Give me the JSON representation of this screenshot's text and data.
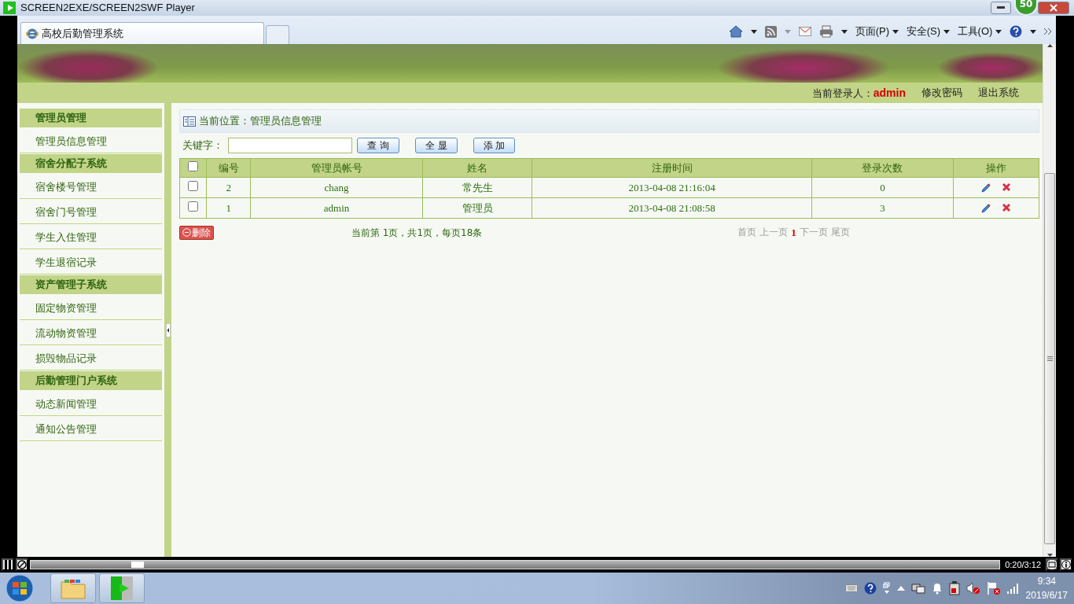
{
  "player": {
    "title": "SCREEN2EXE/SCREEN2SWF Player",
    "badge": "50",
    "time": "0:20/3:12",
    "level": 0.11
  },
  "browser": {
    "tab": "高校后勤管理系统",
    "menus": [
      "页面(P)",
      "安全(S)",
      "工具(O)"
    ]
  },
  "header": {
    "login_label": "当前登录人：",
    "user": "admin",
    "links": [
      "修改密码",
      "退出系统"
    ]
  },
  "sidebar": [
    {
      "title": "管理员管理",
      "items": [
        "管理员信息管理"
      ]
    },
    {
      "title": "宿舍分配子系统",
      "items": [
        "宿舍楼号管理",
        "宿舍门号管理",
        "学生入住管理",
        "学生退宿记录"
      ]
    },
    {
      "title": "资产管理子系统",
      "items": [
        "固定物资管理",
        "流动物资管理",
        "损毁物品记录"
      ]
    },
    {
      "title": "后勤管理门户系统",
      "items": [
        "动态新闻管理",
        "通知公告管理"
      ]
    }
  ],
  "breadcrumb": "当前位置：管理员信息管理",
  "search": {
    "label": "关键字：",
    "buttons": [
      "查 询",
      "全 显",
      "添 加"
    ]
  },
  "table": {
    "select_all_checked": false,
    "columns": [
      "编号",
      "管理员帐号",
      "姓名",
      "注册时间",
      "登录次数",
      "操作"
    ],
    "rows": [
      {
        "checked": false,
        "cells": [
          "2",
          "chang",
          "常先生",
          "2013-04-08 21:16:04",
          "0"
        ]
      },
      {
        "checked": false,
        "cells": [
          "1",
          "admin",
          "管理员",
          "2013-04-08 21:08:58",
          "3"
        ]
      }
    ]
  },
  "delete_button": "删除",
  "page_info": "当前第 1页，共1页，每页18条",
  "pager": [
    {
      "label": "首页",
      "selected": false
    },
    {
      "label": "上一页",
      "selected": false
    },
    {
      "label": "1",
      "selected": true
    },
    {
      "label": "下一页",
      "selected": false
    },
    {
      "label": "尾页",
      "selected": false
    }
  ],
  "taskbar": {
    "time": "9:34",
    "date": "2019/6/17"
  }
}
